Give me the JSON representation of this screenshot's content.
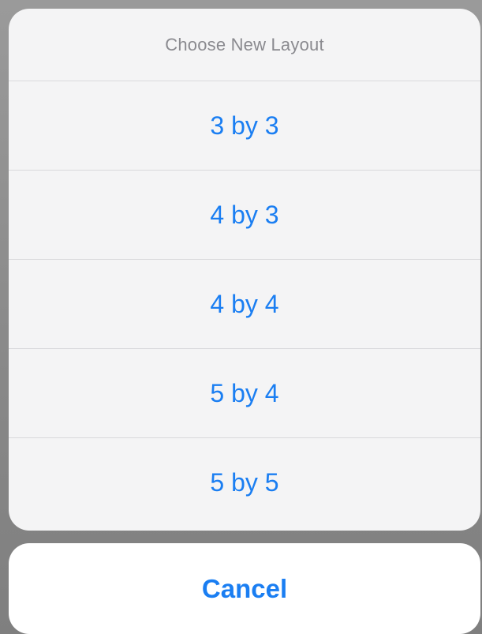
{
  "action_sheet": {
    "title": "Choose New Layout",
    "options": [
      {
        "label": "3 by 3"
      },
      {
        "label": "4 by 3"
      },
      {
        "label": "4 by 4"
      },
      {
        "label": "5 by 4"
      },
      {
        "label": "5 by 5"
      }
    ],
    "cancel_label": "Cancel"
  },
  "colors": {
    "accent": "#1a7ef2",
    "sheet_background": "#f4f4f5",
    "title_text": "#8a8a8f",
    "overlay": "#8e8e8e"
  }
}
